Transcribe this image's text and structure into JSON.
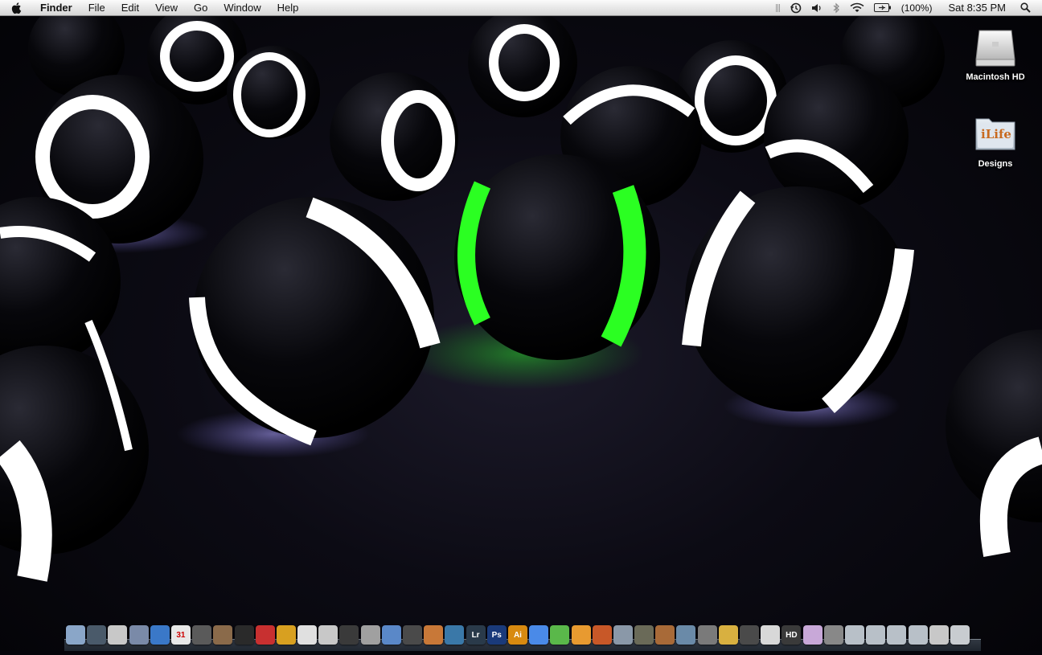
{
  "menubar": {
    "apple_icon": "apple-icon",
    "items": [
      "Finder",
      "File",
      "Edit",
      "View",
      "Go",
      "Window",
      "Help"
    ],
    "battery_percent": "(100%)",
    "clock": "Sat 8:35 PM",
    "status_icons": [
      "time-machine-icon",
      "volume-icon",
      "bluetooth-icon",
      "wifi-icon",
      "battery-icon",
      "spotlight-icon"
    ]
  },
  "desktop": {
    "icons": [
      {
        "label": "Macintosh HD",
        "icon": "hard-drive-icon"
      },
      {
        "label": "Designs",
        "icon": "ilife-folder-icon",
        "badge": "iLife"
      }
    ]
  },
  "dock": {
    "items": [
      {
        "name": "finder",
        "color": "#8aa6c8",
        "text": ""
      },
      {
        "name": "app-2",
        "color": "#4a5a6a",
        "text": ""
      },
      {
        "name": "mail",
        "color": "#c8c8c8",
        "text": ""
      },
      {
        "name": "app-4",
        "color": "#7a8aa8",
        "text": ""
      },
      {
        "name": "safari",
        "color": "#3a78c8",
        "text": ""
      },
      {
        "name": "ical",
        "color": "#e8e8e8",
        "text": "31"
      },
      {
        "name": "app-7",
        "color": "#5a5a5a",
        "text": ""
      },
      {
        "name": "app-8",
        "color": "#8a6a4a",
        "text": ""
      },
      {
        "name": "app-9",
        "color": "#2a2a2a",
        "text": ""
      },
      {
        "name": "app-10",
        "color": "#c83030",
        "text": ""
      },
      {
        "name": "app-11",
        "color": "#d8a020",
        "text": ""
      },
      {
        "name": "app-12",
        "color": "#e0e0e0",
        "text": ""
      },
      {
        "name": "app-13",
        "color": "#c8c8c8",
        "text": ""
      },
      {
        "name": "app-14",
        "color": "#3a3a3a",
        "text": ""
      },
      {
        "name": "app-15",
        "color": "#a0a0a0",
        "text": ""
      },
      {
        "name": "app-16",
        "color": "#5a88c8",
        "text": ""
      },
      {
        "name": "app-17",
        "color": "#4a4a4a",
        "text": ""
      },
      {
        "name": "app-18",
        "color": "#c87838",
        "text": ""
      },
      {
        "name": "app-19",
        "color": "#3a78a8",
        "text": ""
      },
      {
        "name": "lightroom",
        "color": "#2a3a4a",
        "text": "Lr"
      },
      {
        "name": "photoshop",
        "color": "#1a3a7a",
        "text": "Ps"
      },
      {
        "name": "illustrator",
        "color": "#d88a10",
        "text": "Ai"
      },
      {
        "name": "app-23",
        "color": "#4a8ae8",
        "text": ""
      },
      {
        "name": "app-24",
        "color": "#5ab84a",
        "text": ""
      },
      {
        "name": "app-25",
        "color": "#e89a30",
        "text": ""
      },
      {
        "name": "app-26",
        "color": "#c85828",
        "text": ""
      },
      {
        "name": "app-27",
        "color": "#8a98a8",
        "text": ""
      },
      {
        "name": "app-28",
        "color": "#6a6a58",
        "text": ""
      },
      {
        "name": "app-29",
        "color": "#a86a38",
        "text": ""
      },
      {
        "name": "app-30",
        "color": "#6a8aa8",
        "text": ""
      },
      {
        "name": "app-31",
        "color": "#7a7a7a",
        "text": ""
      },
      {
        "name": "app-32",
        "color": "#d8b040",
        "text": ""
      },
      {
        "name": "app-33",
        "color": "#4a4a4a",
        "text": ""
      },
      {
        "name": "app-34",
        "color": "#d8d8d8",
        "text": ""
      },
      {
        "name": "app-35",
        "color": "#3a3a3a",
        "text": "HD"
      },
      {
        "name": "app-36",
        "color": "#c8a8d8",
        "text": ""
      },
      {
        "name": "app-37",
        "color": "#888888",
        "text": ""
      },
      {
        "name": "stack-1",
        "color": "#b8c0c8",
        "text": ""
      },
      {
        "name": "stack-2",
        "color": "#b8c0c8",
        "text": ""
      },
      {
        "name": "stack-3",
        "color": "#b8c0c8",
        "text": ""
      },
      {
        "name": "stack-4",
        "color": "#b8c0c8",
        "text": ""
      },
      {
        "name": "stack-5",
        "color": "#c8c8c8",
        "text": ""
      },
      {
        "name": "trash",
        "color": "#c8ccd0",
        "text": ""
      }
    ]
  }
}
